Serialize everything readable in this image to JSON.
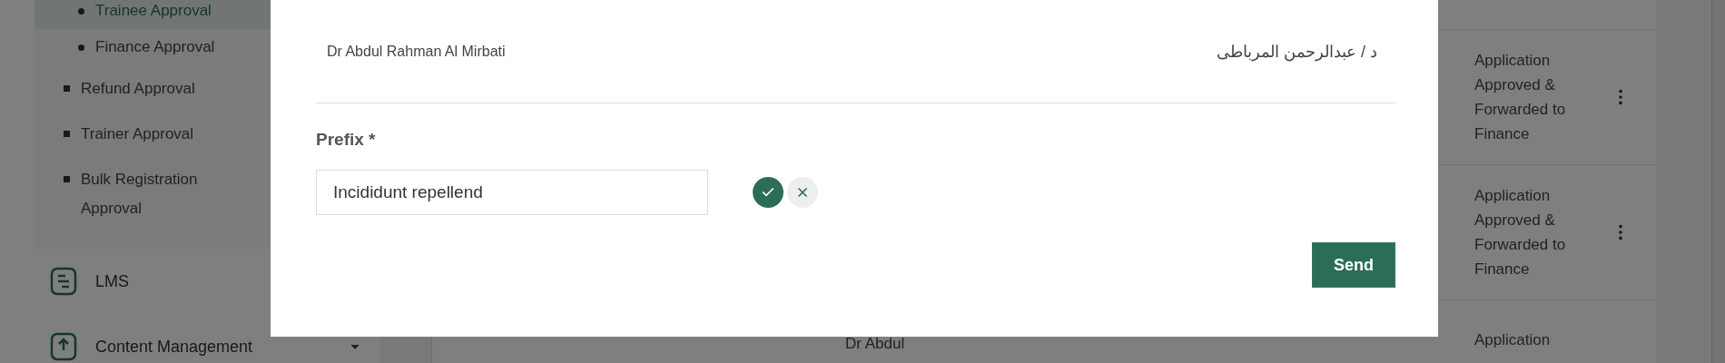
{
  "sidebar": {
    "subitems": [
      {
        "label": "Trainee Approval",
        "selected": true
      },
      {
        "label": "Finance Approval",
        "selected": false
      }
    ],
    "items": [
      {
        "label": "Refund Approval"
      },
      {
        "label": "Trainer Approval"
      },
      {
        "label": "Bulk Registration Approval"
      }
    ],
    "nav": [
      {
        "label": "LMS",
        "kind": "list"
      },
      {
        "label": "Content Management",
        "kind": "upload",
        "expandable": true
      }
    ]
  },
  "table": {
    "rows": [
      {
        "status": "Application Approved & Forwarded to Finance",
        "menu": true
      },
      {
        "status": "Application Approved & Forwarded to Finance",
        "menu": true
      },
      {
        "name": "Dr Abdul",
        "status": "Application",
        "menu": false
      }
    ]
  },
  "modal": {
    "name_en": "Dr Abdul Rahman Al Mirbati",
    "name_ar": "د / عبدالرحمن المرباطى",
    "field": {
      "label": "Prefix *",
      "value": "Incididunt repellend"
    },
    "send": "Send"
  }
}
